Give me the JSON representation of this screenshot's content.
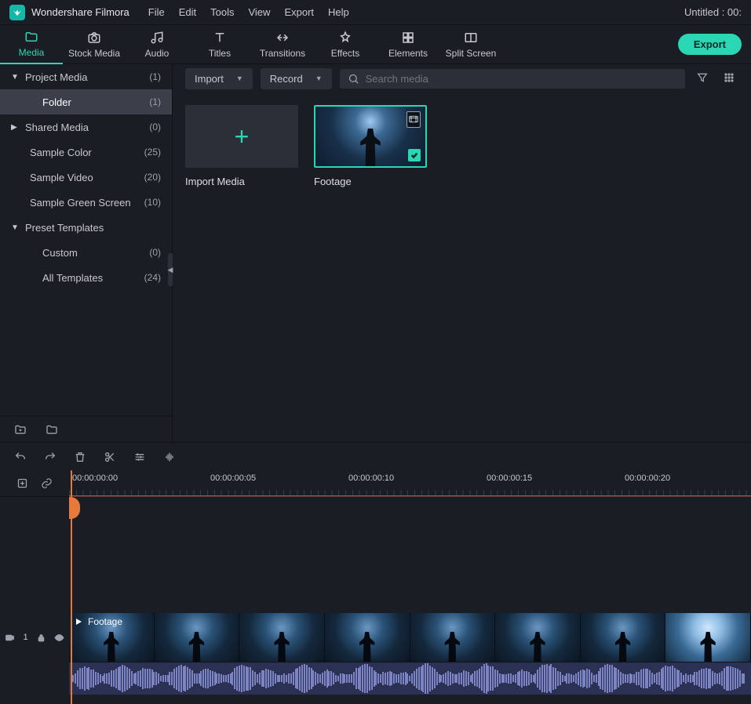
{
  "app": {
    "name": "Wondershare Filmora",
    "project_title": "Untitled : 00:"
  },
  "menu": {
    "file": "File",
    "edit": "Edit",
    "tools": "Tools",
    "view": "View",
    "export": "Export",
    "help": "Help"
  },
  "tabs": {
    "media": "Media",
    "stock": "Stock Media",
    "audio": "Audio",
    "titles": "Titles",
    "transitions": "Transitions",
    "effects": "Effects",
    "elements": "Elements",
    "split": "Split Screen"
  },
  "export_btn": "Export",
  "sidebar": {
    "project_media": {
      "label": "Project Media",
      "count": "(1)"
    },
    "folder": {
      "label": "Folder",
      "count": "(1)"
    },
    "shared_media": {
      "label": "Shared Media",
      "count": "(0)"
    },
    "sample_color": {
      "label": "Sample Color",
      "count": "(25)"
    },
    "sample_video": {
      "label": "Sample Video",
      "count": "(20)"
    },
    "sample_green": {
      "label": "Sample Green Screen",
      "count": "(10)"
    },
    "preset_templates": {
      "label": "Preset Templates"
    },
    "custom": {
      "label": "Custom",
      "count": "(0)"
    },
    "all_templates": {
      "label": "All Templates",
      "count": "(24)"
    }
  },
  "content_bar": {
    "import": "Import",
    "record": "Record",
    "search_placeholder": "Search media"
  },
  "tiles": {
    "import_media": "Import Media",
    "footage": "Footage"
  },
  "ruler": [
    "00:00:00:00",
    "00:00:00:05",
    "00:00:00:10",
    "00:00:00:15",
    "00:00:00:20"
  ],
  "clip": {
    "name": "Footage"
  },
  "track": {
    "video1": "1"
  }
}
